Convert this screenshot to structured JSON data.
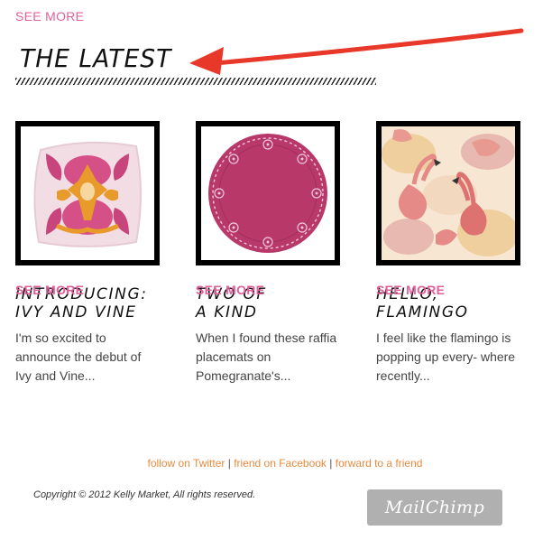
{
  "header": {
    "see_more_label": "SEE MORE",
    "section_title": "THE LATEST"
  },
  "colors": {
    "link_pink": "#e0609a",
    "footer_orange": "#e88a3e",
    "arrow_red": "#e8382a",
    "badge_gray": "#b0b0b0"
  },
  "cards": [
    {
      "title_line1": "INTRODUCING:",
      "title_line2": "IVY AND VINE",
      "excerpt": "I'm so excited to announce the debut of Ivy and Vine...",
      "link_label": "SEE MORE",
      "image": "pink-ikat-pillow"
    },
    {
      "title_line1": "TWO OF",
      "title_line2": "A KIND",
      "excerpt": "When I found these raffia placemats on Pomegranate's...",
      "link_label": "SEE MORE",
      "image": "pink-raffia-placemat"
    },
    {
      "title_line1": "HELLO,",
      "title_line2": "FLAMINGO",
      "excerpt": "I feel like the flamingo is popping up every- where recently...",
      "link_label": "SEE MORE",
      "image": "flamingo-print"
    }
  ],
  "footer": {
    "twitter_label": "follow on Twitter",
    "separator": "|",
    "facebook_label": "friend on Facebook",
    "forward_label": "forward to a friend",
    "copyright": "Copyright © 2012 Kelly Market, All rights reserved.",
    "badge_label": "MailChimp"
  }
}
